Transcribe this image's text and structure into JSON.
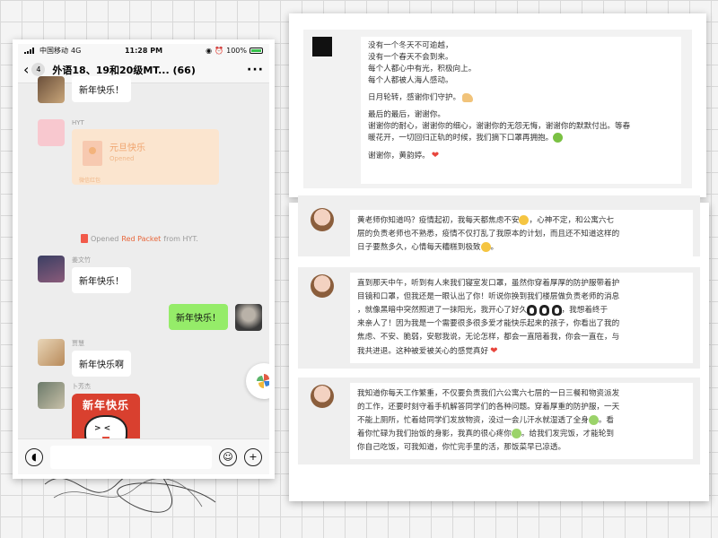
{
  "status_bar": {
    "carrier": "中国移动",
    "network": "4G",
    "time": "11:28 PM",
    "battery": "100%",
    "battery_level": 1.0
  },
  "chat_header": {
    "unread": "4",
    "title": "外语18、19和20级MT...",
    "member_count": "(66)"
  },
  "messages": [
    {
      "text": "新年快乐！"
    },
    {
      "sender": "HYT",
      "red_packet": {
        "title": "元旦快乐",
        "status": "Opened",
        "footer": "微信红包"
      }
    },
    {
      "system": {
        "prefix": "Opened",
        "link": "Red Packet",
        "suffix": "from HYT."
      }
    },
    {
      "sender": "姜文竹",
      "text": "新年快乐！"
    },
    {
      "text": "新年快乐！",
      "self": true
    },
    {
      "sender": "贾慧",
      "text": "新年快乐啊"
    },
    {
      "sender": "卜芳杰",
      "sticker_text": "新年快乐"
    }
  ],
  "colors": {
    "self_bubble": "#95ec69",
    "red_packet": "#fbe5cf",
    "sticker": "#d9402f"
  },
  "top_card": {
    "lines_a": [
      "没有一个冬天不可逾越，",
      "没有一个春天不会到来。",
      "每个人都心中有光，积极向上。",
      "每个人都被人海人感动。"
    ],
    "line_b": "日月轮转，感谢你们守护。",
    "lines_c": [
      "最后的最后，谢谢你。",
      "谢谢你的耐心，谢谢你的细心，谢谢你的无怨无悔，谢谢你的默默付出。等春",
      "暖花开，一切回归正轨的时候，我们摘下口罩再拥抱。"
    ],
    "line_d": "谢谢你，黄韵婷。"
  },
  "bottom_card": {
    "msg1": {
      "line1": "黄老师你知道吗？疫情起初，我每天都焦虑不安",
      "line1b": "，心神不定，和公寓六七",
      "line2": "层的负责老师也不熟悉，疫情不仅打乱了我原本的计划，而且还不知道这样的",
      "line3": "日子要熬多久，心情每天糟糕到极致",
      "line3b": "。"
    },
    "msg2": {
      "line1": "直到那天中午，听到有人来我们寝室发口罩，虽然你穿着厚厚的防护服带着护",
      "line2": "目镜和口罩，但我还是一眼认出了你！听说你换到我们楼层做负责老师的消息",
      "line3": "，就像黑暗中突然照进了一抹阳光，我开心了好久",
      "line3b": "，我想着终于",
      "line4": "来亲人了！因为我是一个需要很多很多爱才能快乐起来的孩子，你看出了我的",
      "line5": "焦虑、不安、脆弱，安慰我说，无论怎样，都会一直陪着我，你会一直在，与",
      "line6": "我共进退。这种被爱被关心的感觉真好"
    },
    "msg3": {
      "line1": "我知道你每天工作繁重，不仅要负责我们六公寓六七层的一日三餐和物资派发",
      "line2": "的工作，还要时刻守着手机解答同学们的各种问题。穿着厚重的防护服，一天",
      "line3": "不能上厕所，忙着给同学们发放物资，没过一会儿汗水就湿透了全身",
      "line3b": "。看",
      "line4": "着你忙碌为我们抬饭的身影，我真的很心疼你",
      "line4b": "。给我们发完饭，才能轮到",
      "line5": "你自己吃饭，可我知道，你忙完手里的活，那饭菜早已凉透。"
    }
  }
}
